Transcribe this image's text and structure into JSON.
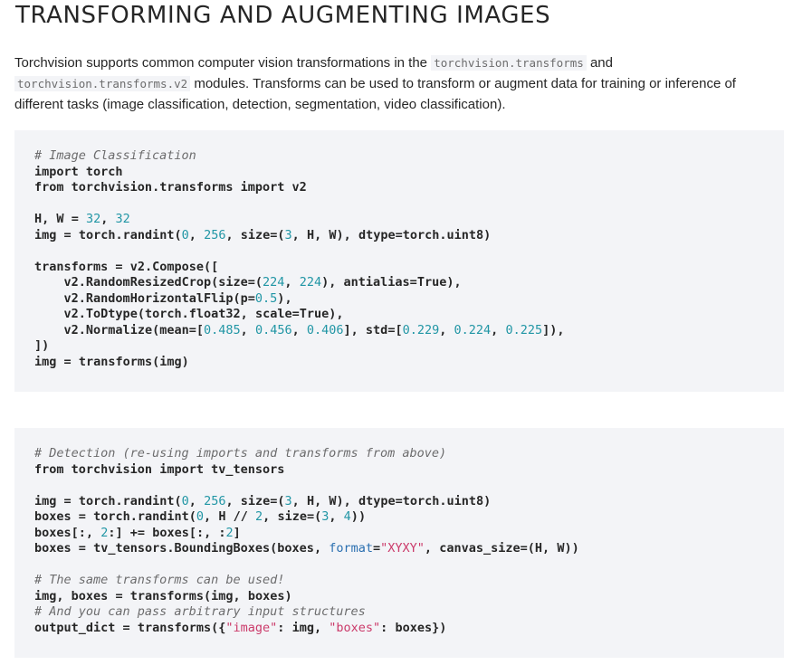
{
  "title": "TRANSFORMING AND AUGMENTING IMAGES",
  "intro": {
    "text_1": "Torchvision supports common computer vision transformations in the ",
    "code_1": "torchvision.transforms",
    "text_2": " and ",
    "code_2": "torchvision.transforms.v2",
    "text_3": " modules. Transforms can be used to transform or augment data for training or inference of different tasks (image classification, detection, segmentation, video classification)."
  },
  "code_blocks": [
    {
      "language": "python",
      "lines": [
        "# Image Classification",
        "import torch",
        "from torchvision.transforms import v2",
        "",
        "H, W = 32, 32",
        "img = torch.randint(0, 256, size=(3, H, W), dtype=torch.uint8)",
        "",
        "transforms = v2.Compose([",
        "    v2.RandomResizedCrop(size=(224, 224), antialias=True),",
        "    v2.RandomHorizontalFlip(p=0.5),",
        "    v2.ToDtype(torch.float32, scale=True),",
        "    v2.Normalize(mean=[0.485, 0.456, 0.406], std=[0.229, 0.224, 0.225]),",
        "])",
        "img = transforms(img)"
      ]
    },
    {
      "language": "python",
      "lines": [
        "# Detection (re-using imports and transforms from above)",
        "from torchvision import tv_tensors",
        "",
        "img = torch.randint(0, 256, size=(3, H, W), dtype=torch.uint8)",
        "boxes = torch.randint(0, H // 2, size=(3, 4))",
        "boxes[:, 2:] += boxes[:, :2]",
        "boxes = tv_tensors.BoundingBoxes(boxes, format=\"XYXY\", canvas_size=(H, W))",
        "",
        "# The same transforms can be used!",
        "img, boxes = transforms(img, boxes)",
        "# And you can pass arbitrary input structures",
        "output_dict = transforms({\"image\": img, \"boxes\": boxes})"
      ]
    }
  ]
}
